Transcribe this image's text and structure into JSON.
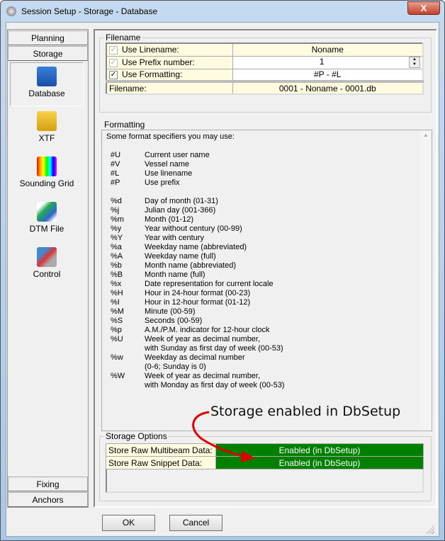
{
  "window": {
    "title": "Session Setup - Storage -  Database",
    "close": "X"
  },
  "nav": {
    "tabs_top": [
      "Planning",
      "Storage"
    ],
    "items": [
      {
        "label": "Database",
        "icon": "floppy-disk-icon"
      },
      {
        "label": "XTF",
        "icon": "xtf-disk-icon"
      },
      {
        "label": "Sounding Grid",
        "icon": "grid-icon"
      },
      {
        "label": "DTM File",
        "icon": "dtm-icon"
      },
      {
        "label": "Control",
        "icon": "control-icon"
      }
    ],
    "tabs_bottom": [
      "Fixing",
      "Anchors"
    ]
  },
  "filename": {
    "title": "Filename",
    "rows": [
      {
        "label": "Use Linename:",
        "value": "Noname",
        "checked": true,
        "enabled": false
      },
      {
        "label": "Use Prefix number:",
        "value": "1",
        "checked": true,
        "enabled": false
      },
      {
        "label": "Use Formatting:",
        "value": "#P - #L",
        "checked": true,
        "enabled": true
      }
    ],
    "result_label": "Filename:",
    "result_value": "0001 - Noname - 0001.db"
  },
  "formatting": {
    "title": "Formatting",
    "intro": "Some format specifiers you may use:",
    "lines": [
      [
        "#U",
        "Current user name"
      ],
      [
        "#V",
        "Vessel name"
      ],
      [
        "#L",
        "Use linename"
      ],
      [
        "#P",
        "Use prefix"
      ],
      [
        "",
        ""
      ],
      [
        "%d",
        "Day of month (01-31)"
      ],
      [
        "%j",
        "Julian day (001-366)"
      ],
      [
        "%m",
        "Month (01-12)"
      ],
      [
        "%y",
        "Year without century (00-99)"
      ],
      [
        "%Y",
        "Year with century"
      ],
      [
        "%a",
        "Weekday name (abbreviated)"
      ],
      [
        "%A",
        "Weekday name (full)"
      ],
      [
        "%b",
        "Month name (abbreviated)"
      ],
      [
        "%B",
        "Month name (full)"
      ],
      [
        "%x",
        "Date representation for current locale"
      ],
      [
        "%H",
        "Hour in 24-hour format (00-23)"
      ],
      [
        "%I",
        "Hour in 12-hour format (01-12)"
      ],
      [
        "%M",
        "Minute (00-59)"
      ],
      [
        "%S",
        "Seconds (00-59)"
      ],
      [
        "%p",
        "A.M./P.M. indicator for 12-hour clock"
      ],
      [
        "%U",
        "Week of year as decimal number,"
      ],
      [
        "",
        "with Sunday as first day of week (00-53)"
      ],
      [
        "%w",
        "Weekday as decimal number"
      ],
      [
        "",
        "(0-6; Sunday is 0)"
      ],
      [
        "%W",
        "Week of year as decimal number,"
      ],
      [
        "",
        "with Monday as first day of week (00-53)"
      ]
    ]
  },
  "storage": {
    "title": "Storage Options",
    "rows": [
      {
        "label": "Store Raw Multibeam Data:",
        "value": "Enabled (in DbSetup)"
      },
      {
        "label": "Store Raw Snippet Data:",
        "value": "Enabled (in DbSetup)"
      }
    ]
  },
  "annotation": "Storage enabled in DbSetup",
  "buttons": {
    "ok": "OK",
    "cancel": "Cancel"
  },
  "colors": {
    "enabled": "#008000",
    "label_bg": "#fffbe0",
    "arrow": "#e00000"
  }
}
